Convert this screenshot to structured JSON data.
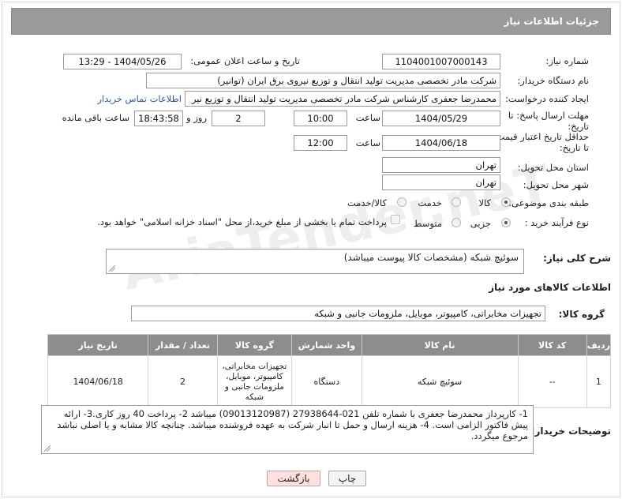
{
  "header": {
    "title": "جزئیات اطلاعات نیاز"
  },
  "need_number": {
    "label": "شماره نیاز:",
    "value": "1104001007000143"
  },
  "announce": {
    "label": "تاریخ و ساعت اعلان عمومی:",
    "value": "1404/05/26 - 13:29"
  },
  "buyer_org": {
    "label": "نام دستگاه خریدار:",
    "value": "شرکت مادر تخصصی مدیریت تولید  انتقال و توزیع نیروی برق ایران (توانیر)"
  },
  "creator": {
    "label": "ایجاد کننده درخواست:",
    "value": "محمدرضا جعفری کارشناس شرکت مادر تخصصی مدیریت تولید  انتقال و توزیع نیر",
    "contact_link": "اطلاعات تماس خریدار"
  },
  "deadline": {
    "label_line1": "مهلت ارسال پاسخ: تا",
    "label_line2": "تاریخ:",
    "date": "1404/05/29",
    "time_label": "ساعت",
    "time": "10:00",
    "days": "2",
    "days_label": "روز و",
    "remaining_time": "18:43:58",
    "remaining_label": "ساعت باقی مانده"
  },
  "price_validity": {
    "label_line1": "حداقل تاریخ اعتبار قیمت:",
    "label_line2": "تا تاریخ:",
    "date": "1404/06/18",
    "time_label": "ساعت",
    "time": "12:00"
  },
  "province": {
    "label": "استان محل تحویل:",
    "value": "تهران"
  },
  "city": {
    "label": "شهر محل تحویل:",
    "value": "تهران"
  },
  "category": {
    "label": "طبقه بندی موضوعی:",
    "options": [
      "کالا",
      "خدمت",
      "کالا/خدمت"
    ],
    "selected": "کالا"
  },
  "process": {
    "label": "نوع فرآیند خرید :",
    "options": [
      "جزیی",
      "متوسط"
    ],
    "selected": "جزیی",
    "payment_note": "پرداخت تمام یا بخشی از مبلغ خرید،از محل \"اسناد خزانه اسلامی\" خواهد بود."
  },
  "summary": {
    "label": "شرح کلی نیاز:",
    "value": "سوئیچ شبکه (مشخصات کالا پیوست میباشد)"
  },
  "goods_info_title": "اطلاعات کالاهای مورد نیاز",
  "goods_group": {
    "label": "گروه کالا:",
    "value": "تجهیزات مخابراتی، کامپیوتر، موبایل، ملزومات جانبی و شبکه"
  },
  "table": {
    "headers": [
      "ردیف",
      "کد کالا",
      "نام کالا",
      "واحد شمارش",
      "گروه کالا",
      "تعداد / مقدار",
      "تاریخ نیاز"
    ],
    "rows": [
      {
        "row": "1",
        "code": "--",
        "name": "سوئیچ شبکه",
        "unit": "دستگاه",
        "group": "تجهیزات مخابراتی، کامپیوتر، موبایل، ملزومات جانبی و شبکه",
        "qty": "2",
        "date": "1404/06/18"
      }
    ]
  },
  "buyer_notes": {
    "label": "توضیحات خریدار:",
    "value": "1- کارپرداز محمدرضا جعفری با شماره تلفن 021-27938644  (09013120987) میباشد 2- پرداخت 40 روز کاری.3- ارائه پیش فاکتور الزامی است. 4- هزینه ارسال و حمل تا انبار شرکت به عهده فروشنده میباشد. چنانچه کالا مشابه و یا اصلی نباشد مرجوع میگردد."
  },
  "buttons": {
    "print": "چاپ",
    "back": "بازگشت"
  },
  "watermark": "AriaTender.neT"
}
